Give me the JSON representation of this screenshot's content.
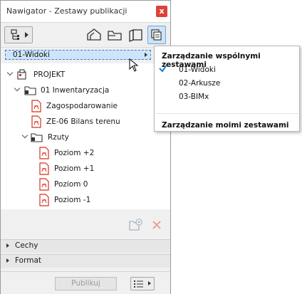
{
  "window": {
    "title": "Nawigator - Zestawy publikacji",
    "close_label": "x"
  },
  "toolbar": {
    "buttons": [
      "navigator-map-button",
      "project-map-icon",
      "view-map-icon",
      "layout-book-icon",
      "publisher-sets-icon"
    ],
    "active": "publisher-sets"
  },
  "set_selector": {
    "value": "01-Widoki"
  },
  "tree": {
    "root": "PROJEKT",
    "folder": "01 Inwentaryzacja",
    "items_a": [
      "Zagospodarowanie",
      "ZE-06 Bilans terenu"
    ],
    "subfolder": "Rzuty",
    "items_b": [
      "Poziom +2",
      "Poziom +1",
      "Poziom 0",
      "Poziom -1"
    ]
  },
  "sections": {
    "cechy": "Cechy",
    "format": "Format"
  },
  "footer": {
    "publish": "Publikuj"
  },
  "menu": {
    "shared_heading": "Zarządzanie wspólnymi zestawami",
    "items": [
      "01-Widoki",
      "02-Arkusze",
      "03-BIMx"
    ],
    "checked": "01-Widoki",
    "own_heading": "Zarządzanie moimi zestawami"
  },
  "colors": {
    "selection": "#cfe4f8",
    "accent": "#1f77d0",
    "close": "#e0403a",
    "pdf_red": "#d2331f"
  }
}
